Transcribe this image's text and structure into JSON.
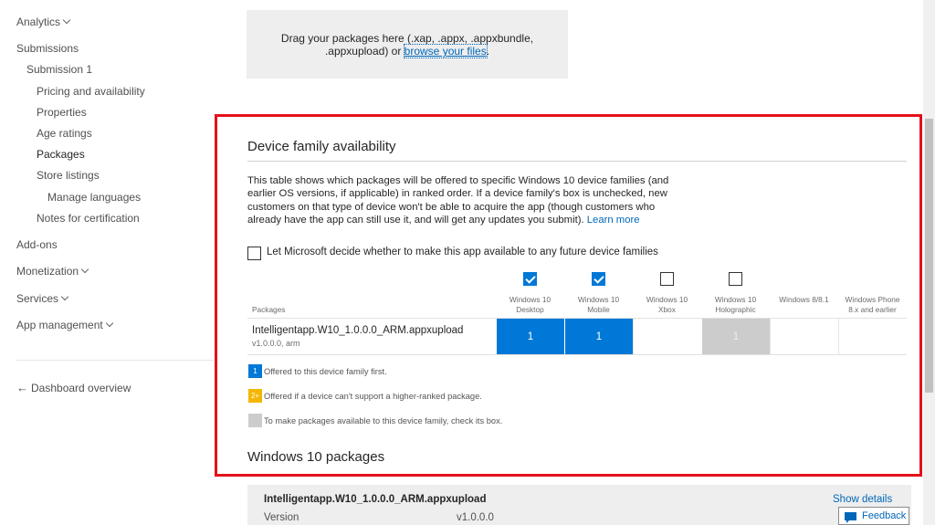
{
  "sidebar": {
    "analytics": "Analytics",
    "submissions": "Submissions",
    "submission_1": "Submission 1",
    "pricing": "Pricing and availability",
    "properties": "Properties",
    "age_ratings": "Age ratings",
    "packages": "Packages",
    "store_listings": "Store listings",
    "manage_languages": "Manage languages",
    "notes": "Notes for certification",
    "addons": "Add-ons",
    "monetization": "Monetization",
    "services": "Services",
    "app_management": "App management",
    "dashboard_overview": "Dashboard overview"
  },
  "dropzone": {
    "text_line1": "Drag your packages here (.xap, .appx, .appxbundle,",
    "text_line2": ".appxupload)  or ",
    "browse_link": "browse your files",
    "end": "."
  },
  "device_family": {
    "title": "Device family availability",
    "description": "This table shows which packages will be offered to specific Windows 10 device families (and earlier OS versions, if applicable) in ranked order. If a device family's box is unchecked, new customers on that type of device won't be able to acquire the app (though customers who already have the app can still use it, and will get any updates you submit).",
    "learn_more": "Learn more",
    "let_microsoft_label": "Let Microsoft decide whether to make this app available to any future device families",
    "packages_header": "Packages",
    "columns": [
      {
        "label": "Windows 10 Desktop",
        "line1": "Windows 10",
        "line2": "Desktop",
        "checked": true,
        "cell": "1",
        "state": "blue"
      },
      {
        "label": "Windows 10 Mobile",
        "line1": "Windows 10",
        "line2": "Mobile",
        "checked": true,
        "cell": "1",
        "state": "blue"
      },
      {
        "label": "Windows 10 Xbox",
        "line1": "Windows 10",
        "line2": "Xbox",
        "checked": false,
        "cell": "",
        "state": "empty"
      },
      {
        "label": "Windows 10 Holographic",
        "line1": "Windows 10",
        "line2": "Holographic",
        "checked": false,
        "cell": "1",
        "state": "gray"
      },
      {
        "label": "Windows 8/8.1",
        "line1": "Windows 8/8.1",
        "line2": "",
        "checked": null,
        "cell": "",
        "state": "empty"
      },
      {
        "label": "Windows Phone 8.x and earlier",
        "line1": "Windows Phone",
        "line2": "8.x and earlier",
        "checked": null,
        "cell": "",
        "state": "empty"
      }
    ],
    "package_row": {
      "name": "Intelligentapp.W10_1.0.0.0_ARM.appxupload",
      "version": "v1.0.0.0, arm"
    },
    "legend": {
      "blue_mark": "1",
      "blue_text": "Offered to this device family first.",
      "yellow_mark": "2+",
      "yellow_text": "Offered if a device can't support a higher-ranked package.",
      "gray_text": "To make packages available to this device family, check its box."
    }
  },
  "win10_packages": {
    "title": "Windows 10 packages",
    "package_name": "Intelligentapp.W10_1.0.0.0_ARM.appxupload",
    "show_details": "Show details",
    "version_label": "Version",
    "version_value": "v1.0.0.0"
  },
  "feedback": "Feedback",
  "colors": {
    "accent": "#0078d7",
    "link": "#0067b8",
    "highlight_border": "#e3101b",
    "rank_yellow": "#f4b600",
    "disabled_gray": "#cccccc"
  }
}
